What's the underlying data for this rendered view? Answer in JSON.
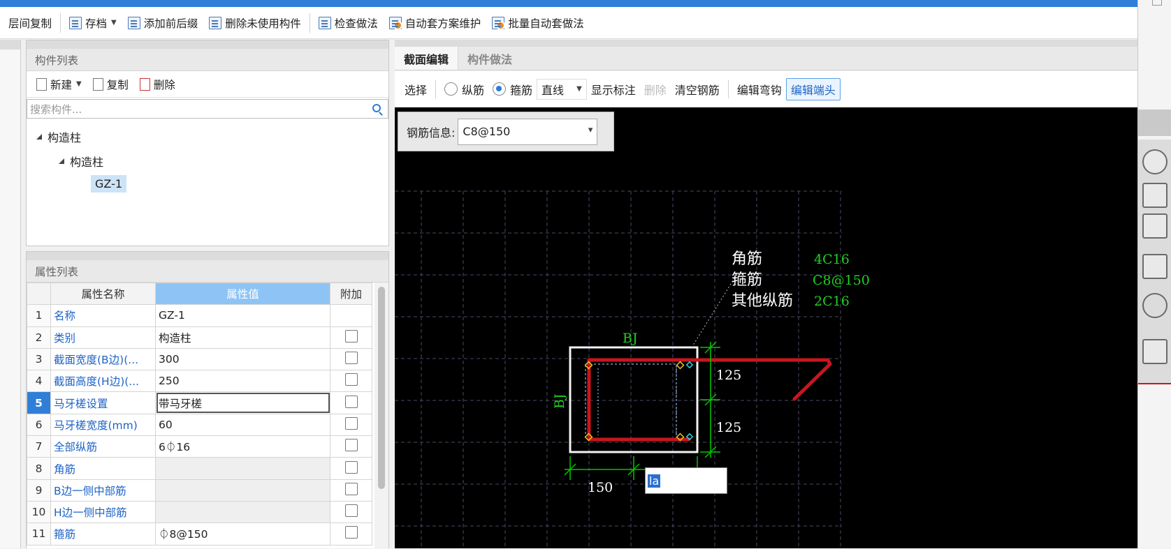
{
  "toolbar": {
    "items": [
      {
        "label": "层间复制"
      },
      {
        "label": "存档",
        "has_menu": true
      },
      {
        "label": "添加前后缀"
      },
      {
        "label": "删除未使用构件"
      },
      {
        "label": "检查做法"
      },
      {
        "label": "自动套方案维护"
      },
      {
        "label": "批量自动套做法"
      }
    ]
  },
  "component_panel": {
    "title": "构件列表",
    "new_label": "新建",
    "copy_label": "复制",
    "delete_label": "删除",
    "search_placeholder": "搜索构件...",
    "tree": {
      "root": "构造柱",
      "child": "构造柱",
      "leaf": "GZ-1"
    }
  },
  "property_panel": {
    "title": "属性列表",
    "headers": {
      "name": "属性名称",
      "value": "属性值",
      "extra": "附加"
    },
    "rows": [
      {
        "n": "1",
        "name": "名称",
        "value": "GZ-1",
        "checkbox": false
      },
      {
        "n": "2",
        "name": "类别",
        "value": "构造柱",
        "checkbox": true
      },
      {
        "n": "3",
        "name": "截面宽度(B边)(...",
        "value": "300",
        "checkbox": true
      },
      {
        "n": "4",
        "name": "截面高度(H边)(...",
        "value": "250",
        "checkbox": true
      },
      {
        "n": "5",
        "name": "马牙槎设置",
        "value": "带马牙槎",
        "checkbox": true
      },
      {
        "n": "6",
        "name": "马牙槎宽度(mm)",
        "value": "60",
        "checkbox": true
      },
      {
        "n": "7",
        "name": "全部纵筋",
        "value": "6⏀16",
        "checkbox": true
      },
      {
        "n": "8",
        "name": "角筋",
        "value": "",
        "checkbox": true
      },
      {
        "n": "9",
        "name": "B边一侧中部筋",
        "value": "",
        "checkbox": true
      },
      {
        "n": "10",
        "name": "H边一侧中部筋",
        "value": "",
        "checkbox": true
      },
      {
        "n": "11",
        "name": "箍筋",
        "value": "⏀8@150",
        "checkbox": true
      }
    ],
    "current_row": "5"
  },
  "editor": {
    "tabs": [
      {
        "label": "截面编辑",
        "active": true
      },
      {
        "label": "构件做法",
        "active": false
      }
    ],
    "toolbar": {
      "select": "选择",
      "radio_long": "纵筋",
      "radio_stirrup": "箍筋",
      "radio_selected": "箍筋",
      "line_mode": "直线",
      "show_dims": "显示标注",
      "delete": "删除",
      "clear": "清空钢筋",
      "edit_hook": "编辑弯钩",
      "edit_end": "编辑端头"
    },
    "rebar_info_label": "钢筋信息:",
    "rebar_info_value": "C8@150",
    "drawing": {
      "legend": [
        {
          "label": "角筋",
          "value": "4C16"
        },
        {
          "label": "箍筋",
          "value": "C8@150"
        },
        {
          "label": "其他纵筋",
          "value": "2C16"
        }
      ],
      "top_label": "BJ",
      "left_label": "BJ",
      "dim_right_1": "125",
      "dim_right_2": "125",
      "dim_bottom": "150",
      "input_value": "la"
    }
  },
  "colors": {
    "accent": "#2f7fd8",
    "rebar": "#c8161d",
    "dim_green": "#00c800",
    "grid": "#4a4a66"
  }
}
